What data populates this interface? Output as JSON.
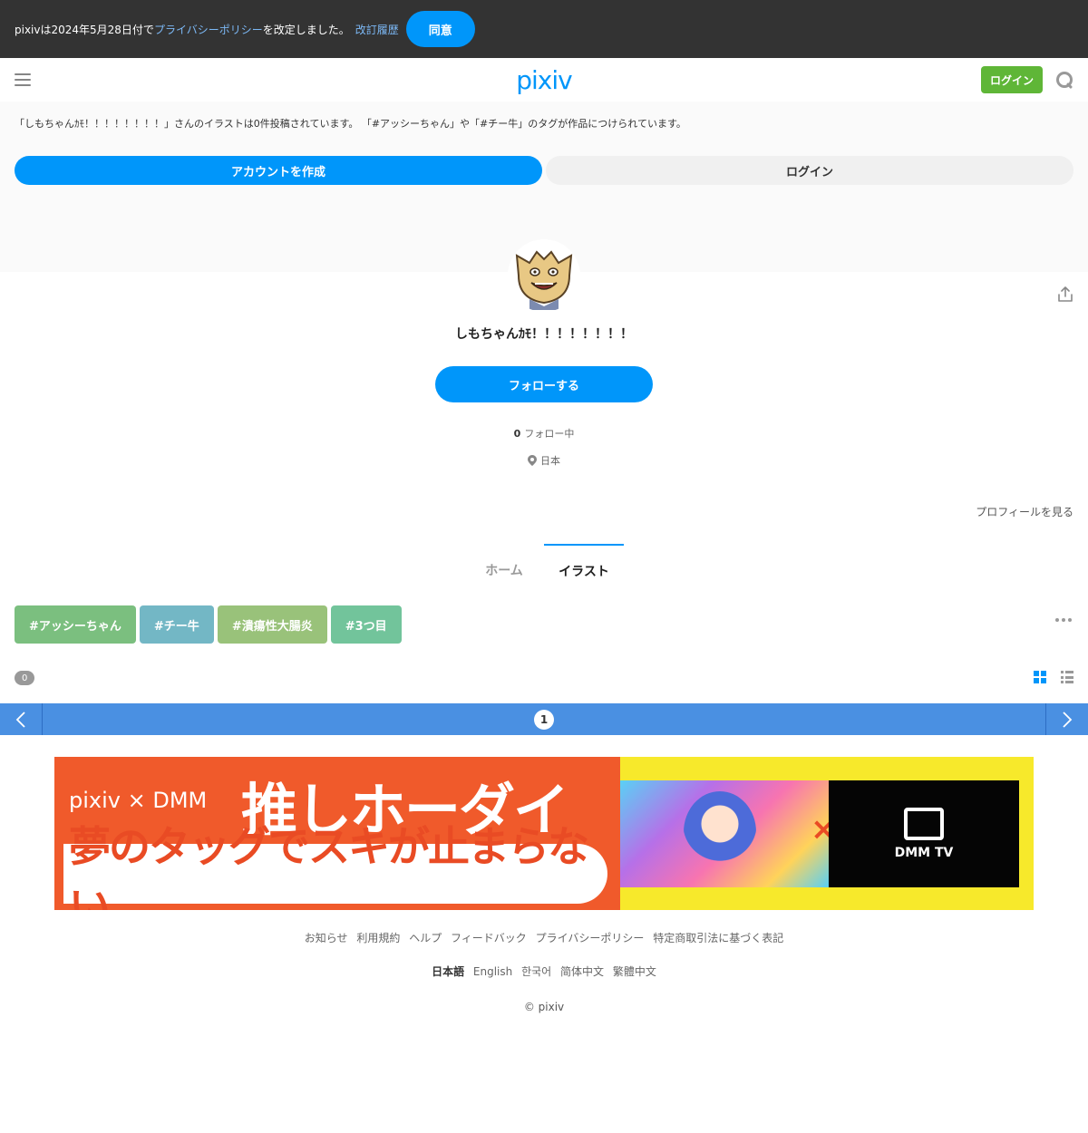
{
  "notice": {
    "prefix": "pixivは2024年5月28日付で",
    "policy_link": "プライバシーポリシー",
    "suffix": "を改定しました。",
    "history_link": "改訂履歴",
    "agree_label": "同意"
  },
  "header": {
    "logo": "pixiv",
    "login_label": "ログイン"
  },
  "intro": {
    "text": "「しもちゃんｶﾓ！！！！！！！！」さんのイラストは0件投稿されています。 「#アッシーちゃん」や「#チー牛」のタグが作品につけられています。",
    "create_account_label": "アカウントを作成",
    "login_label": "ログイン"
  },
  "profile": {
    "username": "しもちゃんｶﾓ！！！！！！！！",
    "follow_label": "フォローする",
    "following_count": "0",
    "following_label": "フォロー中",
    "location": "日本",
    "profile_link": "プロフィールを見る"
  },
  "tabs": [
    {
      "label": "ホーム",
      "active": false
    },
    {
      "label": "イラスト",
      "active": true
    }
  ],
  "tags": [
    {
      "label": "#アッシーちゃん",
      "color": "#7bbf7f"
    },
    {
      "label": "#チー牛",
      "color": "#73b7c5"
    },
    {
      "label": "#潰瘍性大腸炎",
      "color": "#99c27a"
    },
    {
      "label": "#3つ目",
      "color": "#72c49b"
    }
  ],
  "works": {
    "count": "0"
  },
  "pager": {
    "current_page": "1"
  },
  "banner": {
    "brand": "pixiv × DMM",
    "headline": "推しホーダイ",
    "sub": "夢のタッグでスキが止まらない。",
    "dmm_tv": "DMM TV"
  },
  "footer": {
    "links": [
      "お知らせ",
      "利用規約",
      "ヘルプ",
      "フィードバック",
      "プライバシーポリシー",
      "特定商取引法に基づく表記"
    ],
    "languages": [
      "日本語",
      "English",
      "한국어",
      "简体中文",
      "繁體中文"
    ],
    "current_language": "日本語",
    "copyright": "© pixiv"
  },
  "colors": {
    "accent": "#0096fa",
    "login_green": "#5fb637",
    "pager": "#4a90e2",
    "notice_bg": "#333333"
  }
}
